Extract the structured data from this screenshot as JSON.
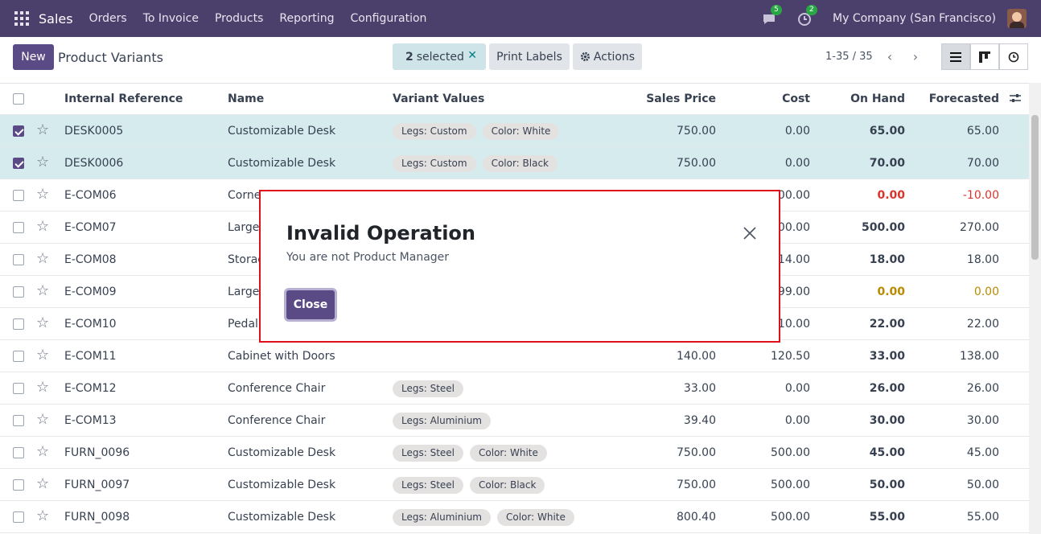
{
  "navbar": {
    "app_name": "Sales",
    "menu": [
      "Orders",
      "To Invoice",
      "Products",
      "Reporting",
      "Configuration"
    ],
    "messages_count": "5",
    "activities_count": "2",
    "company": "My Company (San Francisco)"
  },
  "control": {
    "new_label": "New",
    "title": "Product Variants",
    "selected_count": "2",
    "selected_label": "selected",
    "print_labels": "Print Labels",
    "actions": "Actions",
    "pager": "1-35 / 35"
  },
  "table": {
    "columns": [
      "Internal Reference",
      "Name",
      "Variant Values",
      "Sales Price",
      "Cost",
      "On Hand",
      "Forecasted"
    ],
    "rows": [
      {
        "ref": "DESK0005",
        "name": "Customizable Desk",
        "tags": [
          "Legs: Custom",
          "Color: White"
        ],
        "price": "750.00",
        "cost": "0.00",
        "onhand": "65.00",
        "forecast": "65.00",
        "selected": true
      },
      {
        "ref": "DESK0006",
        "name": "Customizable Desk",
        "tags": [
          "Legs: Custom",
          "Color: Black"
        ],
        "price": "750.00",
        "cost": "0.00",
        "onhand": "70.00",
        "forecast": "70.00",
        "selected": true
      },
      {
        "ref": "E-COM06",
        "name": "Corne",
        "tags": [],
        "price": "",
        "cost": "00.00",
        "onhand": "0.00",
        "forecast": "-10.00",
        "status": "red"
      },
      {
        "ref": "E-COM07",
        "name": "Large",
        "tags": [],
        "price": "",
        "cost": "00.00",
        "onhand": "500.00",
        "forecast": "270.00"
      },
      {
        "ref": "E-COM08",
        "name": "Storag",
        "tags": [],
        "price": "",
        "cost": "14.00",
        "onhand": "18.00",
        "forecast": "18.00"
      },
      {
        "ref": "E-COM09",
        "name": "Large",
        "tags": [],
        "price": "",
        "cost": "99.00",
        "onhand": "0.00",
        "forecast": "0.00",
        "status": "orange"
      },
      {
        "ref": "E-COM10",
        "name": "Pedal",
        "tags": [],
        "price": "",
        "cost": "10.00",
        "onhand": "22.00",
        "forecast": "22.00"
      },
      {
        "ref": "E-COM11",
        "name": "Cabinet with Doors",
        "tags": [],
        "price": "140.00",
        "cost": "120.50",
        "onhand": "33.00",
        "forecast": "138.00"
      },
      {
        "ref": "E-COM12",
        "name": "Conference Chair",
        "tags": [
          "Legs: Steel"
        ],
        "price": "33.00",
        "cost": "0.00",
        "onhand": "26.00",
        "forecast": "26.00"
      },
      {
        "ref": "E-COM13",
        "name": "Conference Chair",
        "tags": [
          "Legs: Aluminium"
        ],
        "price": "39.40",
        "cost": "0.00",
        "onhand": "30.00",
        "forecast": "30.00"
      },
      {
        "ref": "FURN_0096",
        "name": "Customizable Desk",
        "tags": [
          "Legs: Steel",
          "Color: White"
        ],
        "price": "750.00",
        "cost": "500.00",
        "onhand": "45.00",
        "forecast": "45.00"
      },
      {
        "ref": "FURN_0097",
        "name": "Customizable Desk",
        "tags": [
          "Legs: Steel",
          "Color: Black"
        ],
        "price": "750.00",
        "cost": "500.00",
        "onhand": "50.00",
        "forecast": "50.00"
      },
      {
        "ref": "FURN_0098",
        "name": "Customizable Desk",
        "tags": [
          "Legs: Aluminium",
          "Color: White"
        ],
        "price": "800.40",
        "cost": "500.00",
        "onhand": "55.00",
        "forecast": "55.00"
      }
    ]
  },
  "modal": {
    "title": "Invalid Operation",
    "message": "You are not Product Manager",
    "close_label": "Close"
  },
  "colors": {
    "navbar": "#4b3f6b",
    "primary": "#5a4a85",
    "selected_row": "#d6ebee",
    "danger": "#d9342b",
    "warning": "#b98a00"
  }
}
